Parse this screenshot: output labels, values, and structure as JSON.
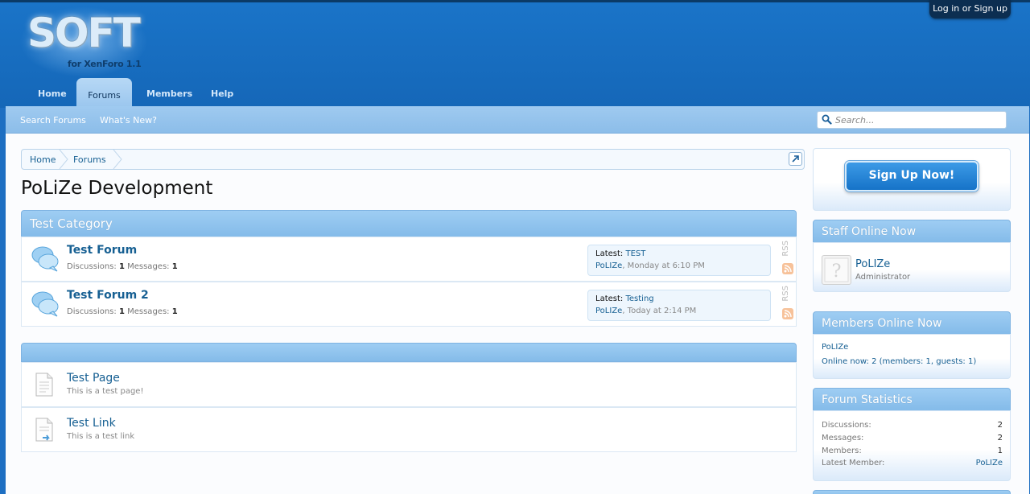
{
  "header": {
    "logo_main": "SOFT",
    "logo_sub": "for XenForo 1.1",
    "login_label": "Log in or Sign up",
    "tabs": [
      {
        "label": "Home",
        "active": false
      },
      {
        "label": "Forums",
        "active": true
      },
      {
        "label": "Members",
        "active": false
      },
      {
        "label": "Help",
        "active": false
      }
    ]
  },
  "subnav": {
    "links": [
      "Search Forums",
      "What's New?"
    ],
    "search_placeholder": "Search..."
  },
  "breadcrumb": [
    "Home",
    "Forums"
  ],
  "page": {
    "title": "PoLiZe Development"
  },
  "category": {
    "title": "Test Category",
    "forums": [
      {
        "title": "Test Forum",
        "discussions_label": "Discussions:",
        "discussions": "1",
        "messages_label": "Messages:",
        "messages": "1",
        "latest_label": "Latest:",
        "latest_title": "TEST",
        "latest_user": "PoLIZe",
        "latest_time": ", Monday at 6:10 PM",
        "rss_label": "RSS"
      },
      {
        "title": "Test Forum 2",
        "discussions_label": "Discussions:",
        "discussions": "1",
        "messages_label": "Messages:",
        "messages": "1",
        "latest_label": "Latest:",
        "latest_title": "Testing",
        "latest_user": "PoLIZe",
        "latest_time": ", Today at 2:14 PM",
        "rss_label": "RSS"
      }
    ]
  },
  "pages": [
    {
      "title": "Test Page",
      "description": "This is a test page!"
    },
    {
      "title": "Test Link",
      "description": "This is a test link"
    }
  ],
  "sidebar": {
    "signup_label": "Sign Up Now!",
    "staff": {
      "title": "Staff Online Now",
      "name": "PoLIZe",
      "role": "Administrator"
    },
    "members_online": {
      "title": "Members Online Now",
      "member": "PoLIZe",
      "summary": "Online now: 2 (members: 1, guests: 1)"
    },
    "stats": {
      "title": "Forum Statistics",
      "rows": [
        {
          "label": "Discussions:",
          "value": "2"
        },
        {
          "label": "Messages:",
          "value": "2"
        },
        {
          "label": "Members:",
          "value": "1"
        },
        {
          "label": "Latest Member:",
          "value": "PoLIZe"
        }
      ]
    }
  },
  "colors": {
    "brand_blue": "#1a74c8",
    "link": "#176093",
    "header_gradient_top": "#9ecdf3"
  }
}
